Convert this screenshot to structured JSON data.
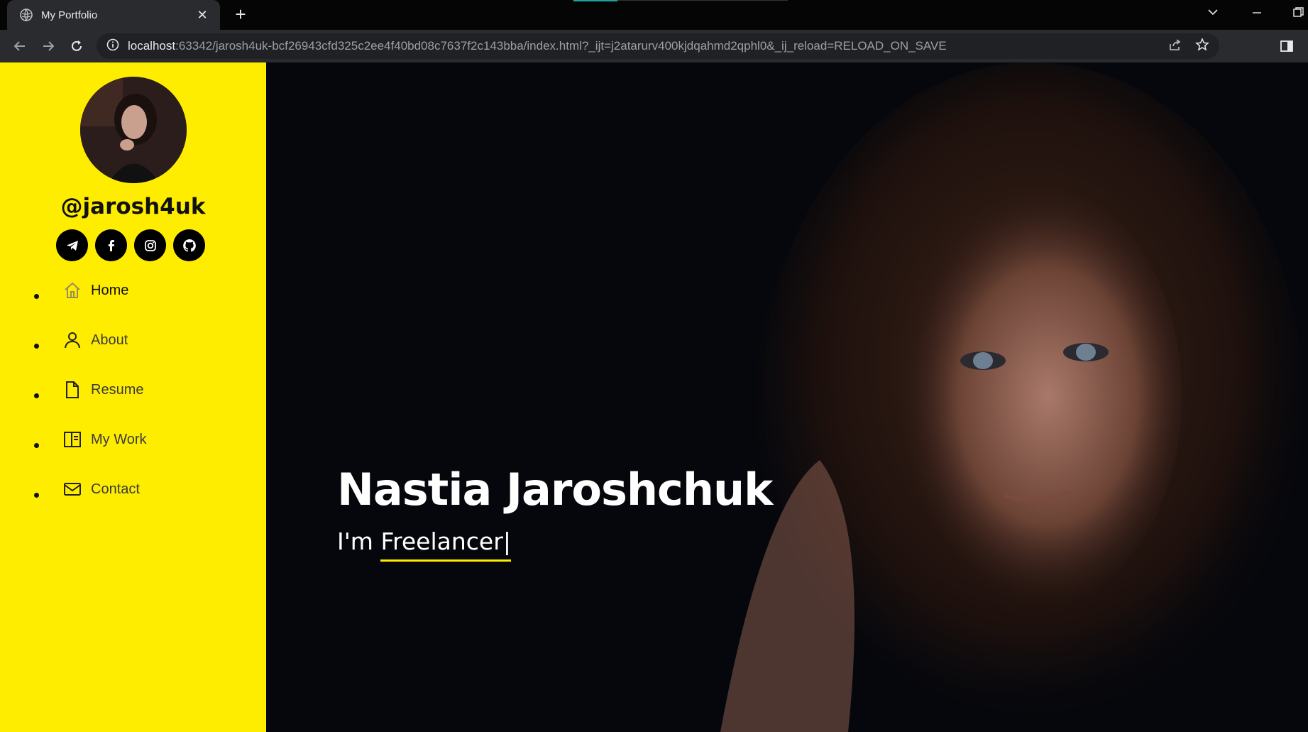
{
  "browser": {
    "tab_title": "My Portfolio",
    "tab_close": "✕",
    "new_tab": "+",
    "url_host": "localhost",
    "url_rest": ":63342/jarosh4uk-bcf26943cfd325c2ee4f40bd08c7637f2c143bba/index.html?_ijt=j2atarurv400kjdqahmd2qphl0&_ij_reload=RELOAD_ON_SAVE"
  },
  "sidebar": {
    "handle": "@jarosh4uk",
    "socials": [
      {
        "icon": "telegram-icon"
      },
      {
        "icon": "facebook-icon"
      },
      {
        "icon": "instagram-icon"
      },
      {
        "icon": "github-icon"
      }
    ],
    "nav": [
      {
        "label": "Home",
        "icon": "home-icon"
      },
      {
        "label": "About",
        "icon": "user-icon"
      },
      {
        "label": "Resume",
        "icon": "document-icon"
      },
      {
        "label": "My Work",
        "icon": "portfolio-icon"
      },
      {
        "label": "Contact",
        "icon": "envelope-icon"
      }
    ]
  },
  "hero": {
    "name": "Nastia Jaroshchuk",
    "intro": "I'm ",
    "typed": "Freelancer",
    "cursor": "|"
  },
  "colors": {
    "sidebar_bg": "#ffed00",
    "page_bg": "#06070c",
    "accent": "#ffed00"
  }
}
